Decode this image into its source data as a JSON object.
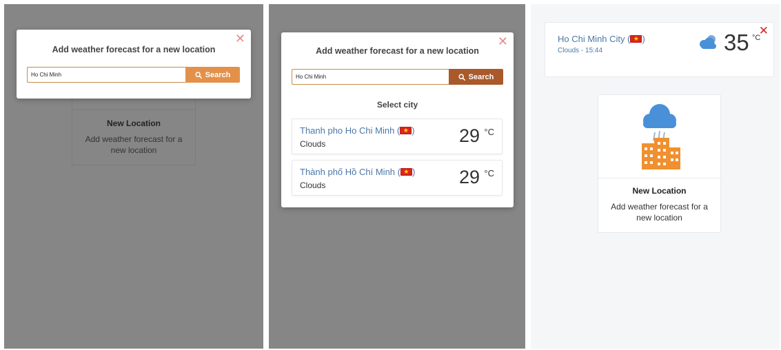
{
  "colors": {
    "overlay": "#868686",
    "accent_orange": "#e3914a",
    "accent_brown": "#a9592a",
    "link_blue": "#4a77a8",
    "close_red": "#d92323",
    "close_pink": "#e88a8a"
  },
  "panel1": {
    "modal": {
      "title": "Add weather forecast for a new location",
      "search_value": "Ho Chi Minh",
      "search_button": "Search"
    },
    "background_card": {
      "title": "New Location",
      "description": "Add weather forecast for a new location"
    }
  },
  "panel2": {
    "modal": {
      "title": "Add weather forecast for a new location",
      "search_value": "Ho Chi Minh",
      "search_button": "Search",
      "select_label": "Select city",
      "results": [
        {
          "name": "Thanh pho Ho Chi Minh (",
          "name_suffix": ")",
          "description": "Clouds",
          "temperature": "29",
          "unit": "°C"
        },
        {
          "name": "Thành phố Hồ Chí Minh (",
          "name_suffix": ")",
          "description": "Clouds",
          "temperature": "29",
          "unit": "°C"
        }
      ]
    }
  },
  "panel3": {
    "location": {
      "name": "Ho Chi Minh City (",
      "name_suffix": ")",
      "subtitle": "Clouds - 15:44",
      "temperature": "35",
      "unit": "°C",
      "icon": "cloud-icon"
    },
    "new_location": {
      "title": "New Location",
      "description": "Add weather forecast for a new location",
      "icon": "city-rain-icon"
    }
  }
}
